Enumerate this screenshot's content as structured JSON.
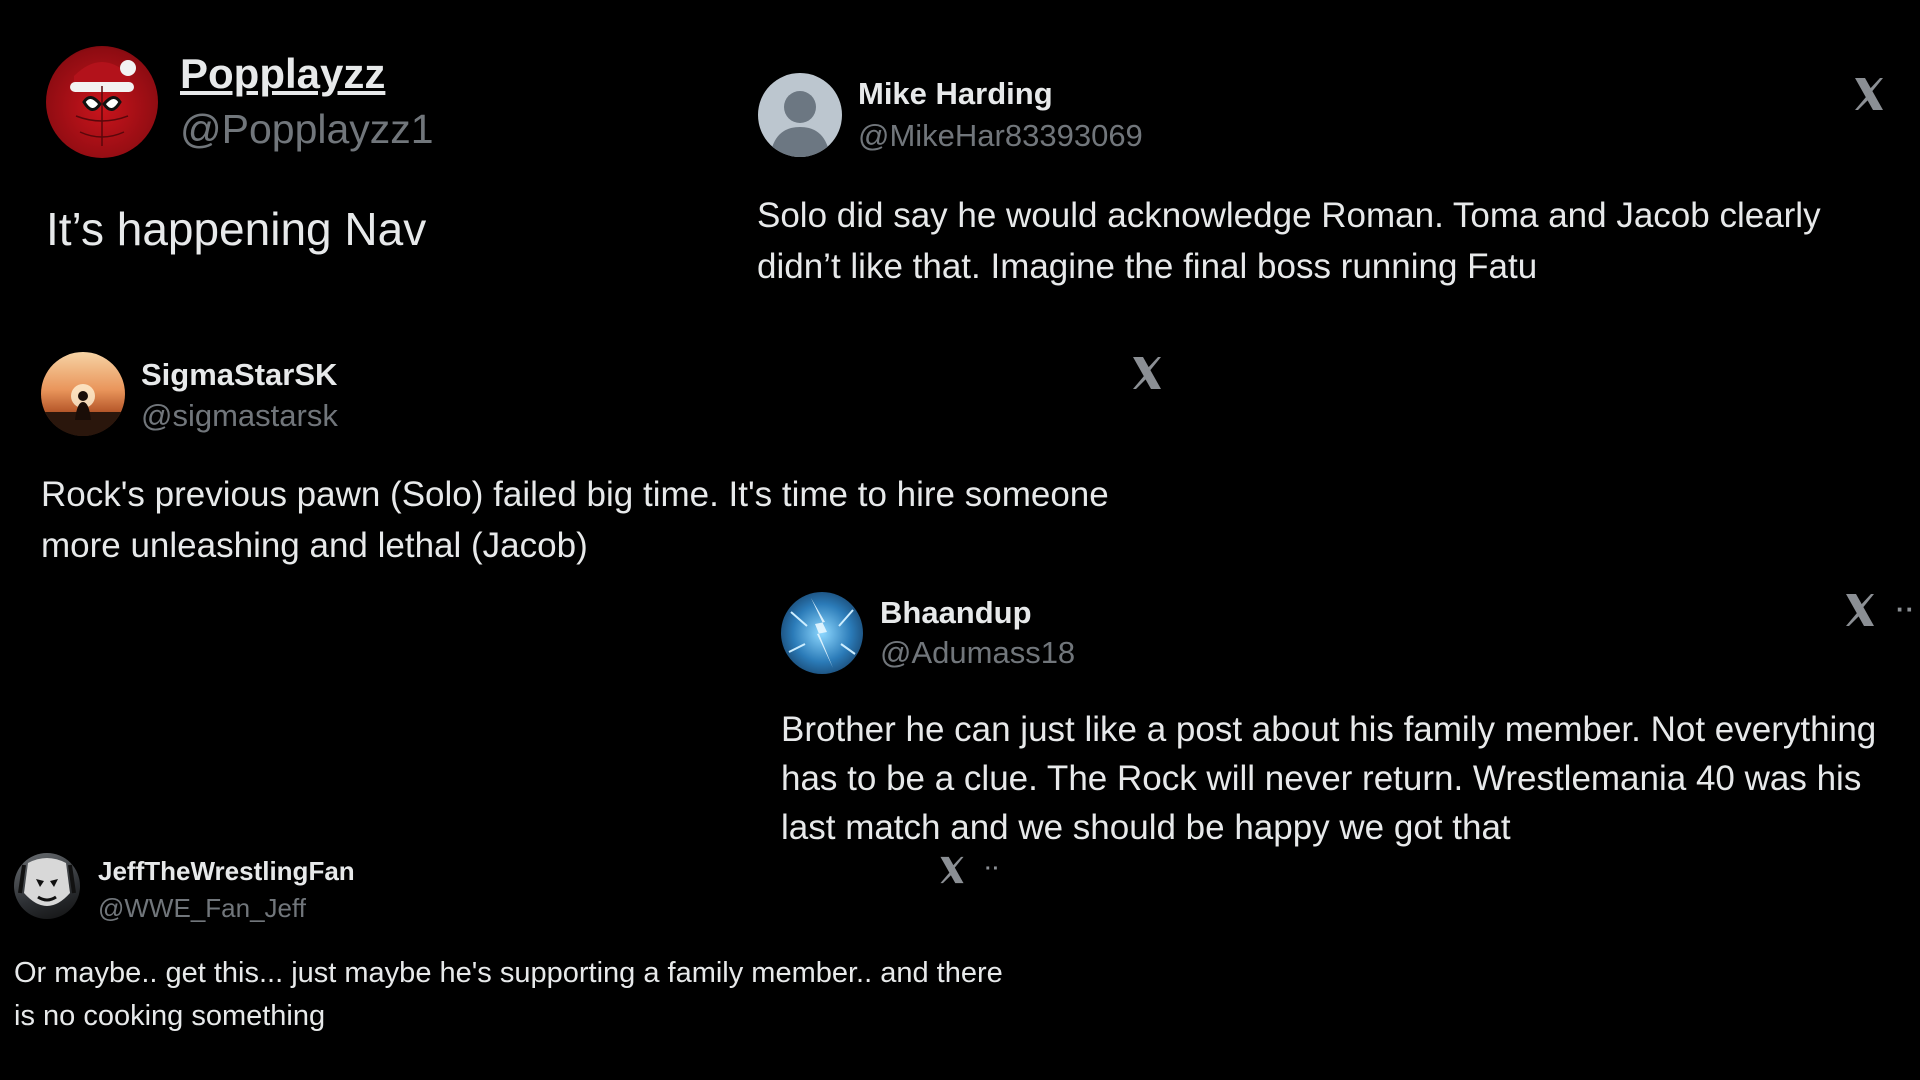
{
  "posts": [
    {
      "name": "Popplayzz",
      "handle": "@Popplayzz1",
      "text": "It’s happening Nav"
    },
    {
      "name": "Mike Harding",
      "handle": "@MikeHar83393069",
      "text": "Solo did say he would acknowledge Roman. Toma and Jacob clearly didn’t like that. Imagine the final boss running Fatu"
    },
    {
      "name": "SigmaStarSK",
      "handle": "@sigmastarsk",
      "text": "Rock's previous pawn (Solo) failed big time. It's time to hire someone more unleashing and lethal (Jacob)"
    },
    {
      "name": "Bhaandup",
      "handle": "@Adumass18",
      "text": "Brother he can just like a post about his family member. Not everything has to be a clue. The Rock will never return. Wrestlemania 40 was his last match and we should be happy we got that"
    },
    {
      "name": "JeffTheWrestlingFan",
      "handle": "@WWE_Fan_Jeff",
      "text": "Or maybe.. get this... just maybe he's supporting a family member.. and there is no cooking something"
    }
  ],
  "more_glyph": "··",
  "colors": {
    "background": "#000000",
    "text_primary": "#e7e9ea",
    "text_secondary": "#71767b"
  },
  "icons": [
    "x-logo-icon",
    "more-icon"
  ]
}
